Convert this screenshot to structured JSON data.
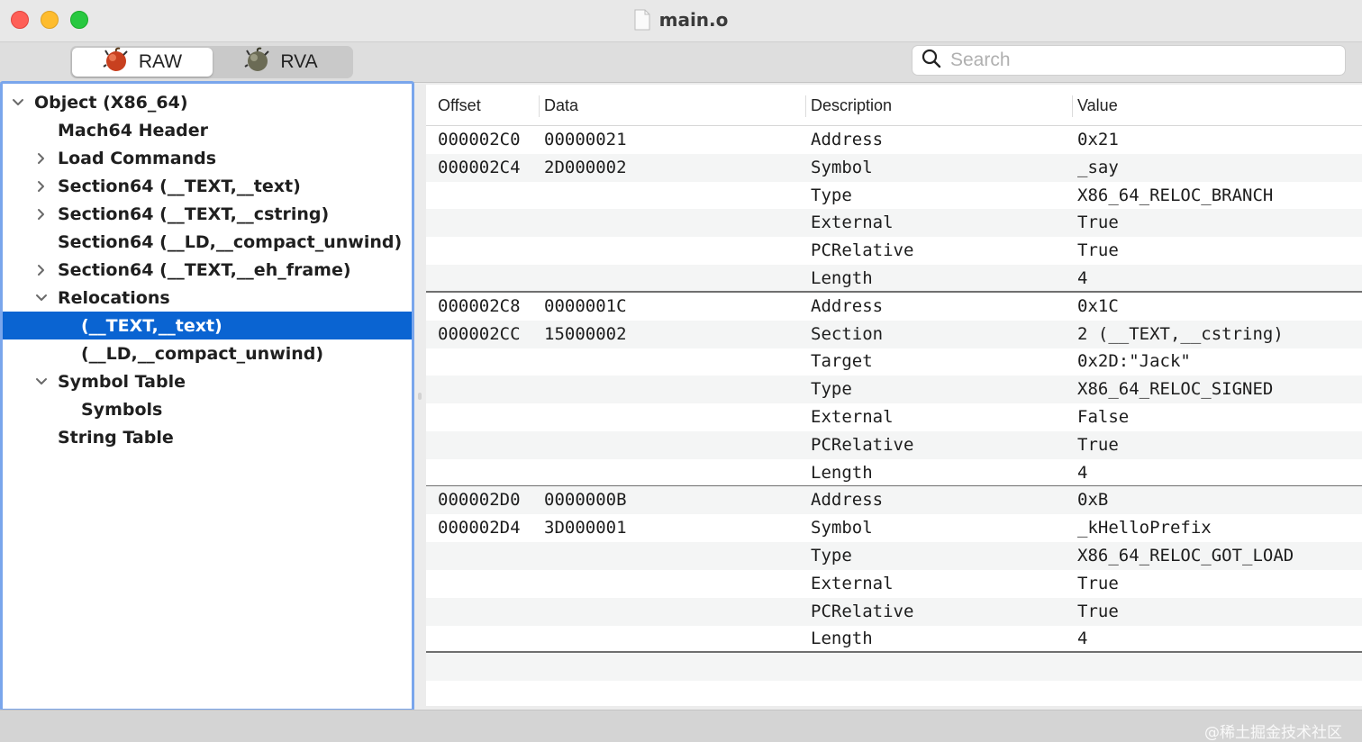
{
  "window": {
    "title": "main.o"
  },
  "toolbar": {
    "modes": [
      {
        "label": "RAW",
        "selected": true
      },
      {
        "label": "RVA",
        "selected": false
      }
    ],
    "search": {
      "value": "",
      "placeholder": "Search"
    }
  },
  "outline": {
    "items": [
      {
        "label": "Object  (X86_64)",
        "expander": "expanded",
        "depth": 0,
        "selected": false
      },
      {
        "label": "Mach64 Header",
        "expander": "none",
        "depth": 1,
        "selected": false
      },
      {
        "label": "Load Commands",
        "expander": "collapsed",
        "depth": 1,
        "selected": false
      },
      {
        "label": "Section64 (__TEXT,__text)",
        "expander": "collapsed",
        "depth": 1,
        "selected": false
      },
      {
        "label": "Section64 (__TEXT,__cstring)",
        "expander": "collapsed",
        "depth": 1,
        "selected": false
      },
      {
        "label": "Section64 (__LD,__compact_unwind)",
        "expander": "none",
        "depth": 1,
        "selected": false
      },
      {
        "label": "Section64 (__TEXT,__eh_frame)",
        "expander": "collapsed",
        "depth": 1,
        "selected": false
      },
      {
        "label": "Relocations",
        "expander": "expanded",
        "depth": 1,
        "selected": false
      },
      {
        "label": "(__TEXT,__text)",
        "expander": "none",
        "depth": 2,
        "selected": true
      },
      {
        "label": "(__LD,__compact_unwind)",
        "expander": "none",
        "depth": 2,
        "selected": false
      },
      {
        "label": "Symbol Table",
        "expander": "expanded",
        "depth": 1,
        "selected": false
      },
      {
        "label": "Symbols",
        "expander": "none",
        "depth": 2,
        "selected": false
      },
      {
        "label": "String Table",
        "expander": "none",
        "depth": 1,
        "selected": false
      }
    ]
  },
  "table": {
    "columns": [
      "Offset",
      "Data",
      "Description",
      "Value"
    ],
    "rows": [
      {
        "offset": "000002C0",
        "data": "00000021",
        "description": "Address",
        "value": "0x21",
        "group_end": false
      },
      {
        "offset": "000002C4",
        "data": "2D000002",
        "description": "Symbol",
        "value": "_say",
        "group_end": false
      },
      {
        "offset": "",
        "data": "",
        "description": "Type",
        "value": "X86_64_RELOC_BRANCH",
        "group_end": false
      },
      {
        "offset": "",
        "data": "",
        "description": "External",
        "value": "True",
        "group_end": false
      },
      {
        "offset": "",
        "data": "",
        "description": "PCRelative",
        "value": "True",
        "group_end": false
      },
      {
        "offset": "",
        "data": "",
        "description": "Length",
        "value": "4",
        "group_end": true
      },
      {
        "offset": "000002C8",
        "data": "0000001C",
        "description": "Address",
        "value": "0x1C",
        "group_end": false
      },
      {
        "offset": "000002CC",
        "data": "15000002",
        "description": "Section",
        "value": "2 (__TEXT,__cstring)",
        "group_end": false
      },
      {
        "offset": "",
        "data": "",
        "description": "Target",
        "value": "0x2D:\"Jack\"",
        "group_end": false
      },
      {
        "offset": "",
        "data": "",
        "description": "Type",
        "value": "X86_64_RELOC_SIGNED",
        "group_end": false
      },
      {
        "offset": "",
        "data": "",
        "description": "External",
        "value": "False",
        "group_end": false
      },
      {
        "offset": "",
        "data": "",
        "description": "PCRelative",
        "value": "True",
        "group_end": false
      },
      {
        "offset": "",
        "data": "",
        "description": "Length",
        "value": "4",
        "group_end": true
      },
      {
        "offset": "000002D0",
        "data": "0000000B",
        "description": "Address",
        "value": "0xB",
        "group_end": false
      },
      {
        "offset": "000002D4",
        "data": "3D000001",
        "description": "Symbol",
        "value": "_kHelloPrefix",
        "group_end": false
      },
      {
        "offset": "",
        "data": "",
        "description": "Type",
        "value": "X86_64_RELOC_GOT_LOAD",
        "group_end": false
      },
      {
        "offset": "",
        "data": "",
        "description": "External",
        "value": "True",
        "group_end": false
      },
      {
        "offset": "",
        "data": "",
        "description": "PCRelative",
        "value": "True",
        "group_end": false
      },
      {
        "offset": "",
        "data": "",
        "description": "Length",
        "value": "4",
        "group_end": true
      }
    ]
  },
  "watermark": "@稀土掘金技术社区",
  "colors": {
    "selection": "#0a64d2",
    "focus_ring": "#7aa6ec",
    "close": "#fe5f57",
    "minimize": "#febc2e",
    "maximize": "#28c840"
  }
}
